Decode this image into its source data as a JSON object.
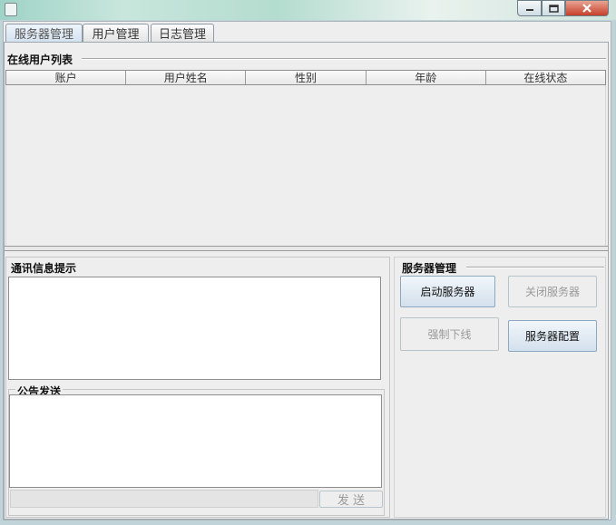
{
  "tabs": [
    {
      "label": "服务器管理"
    },
    {
      "label": "用户管理"
    },
    {
      "label": "日志管理"
    }
  ],
  "online_users": {
    "title": "在线用户列表",
    "columns": [
      "账户",
      "用户姓名",
      "性别",
      "年龄",
      "在线状态"
    ]
  },
  "comm": {
    "title": "通讯信息提示",
    "content": ""
  },
  "announce": {
    "title": "公告发送",
    "content": "",
    "send_label": "发 送"
  },
  "server": {
    "title": "服务器管理",
    "start_label": "启动服务器",
    "stop_label": "关闭服务器",
    "kick_label": "强制下线",
    "config_label": "服务器配置"
  }
}
